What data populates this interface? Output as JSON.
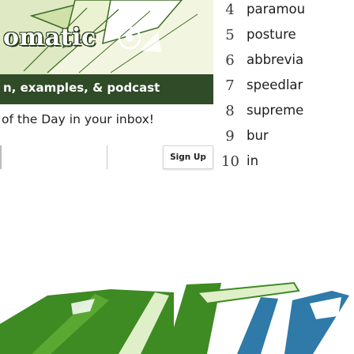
{
  "banner": {
    "wordmark": "omatic",
    "subtitle": "n, examples, & podcast"
  },
  "newsletter": {
    "text": "of the Day in your inbox!",
    "email_placeholder": "",
    "signup_label": "Sign Up"
  },
  "word_list": [
    {
      "num": "4",
      "word": "paramou"
    },
    {
      "num": "5",
      "word": "posture"
    },
    {
      "num": "6",
      "word": "abbrevia"
    },
    {
      "num": "7",
      "word": "speedlar"
    },
    {
      "num": "8",
      "word": "supreme"
    },
    {
      "num": "9",
      "word": "bur"
    },
    {
      "num": "10",
      "word": "in"
    }
  ],
  "colors": {
    "banner_bg": "#f2f6e0",
    "banner_dark": "#2f4b27",
    "art_green": "#3e8a23",
    "art_teal": "#2f7aa8"
  }
}
